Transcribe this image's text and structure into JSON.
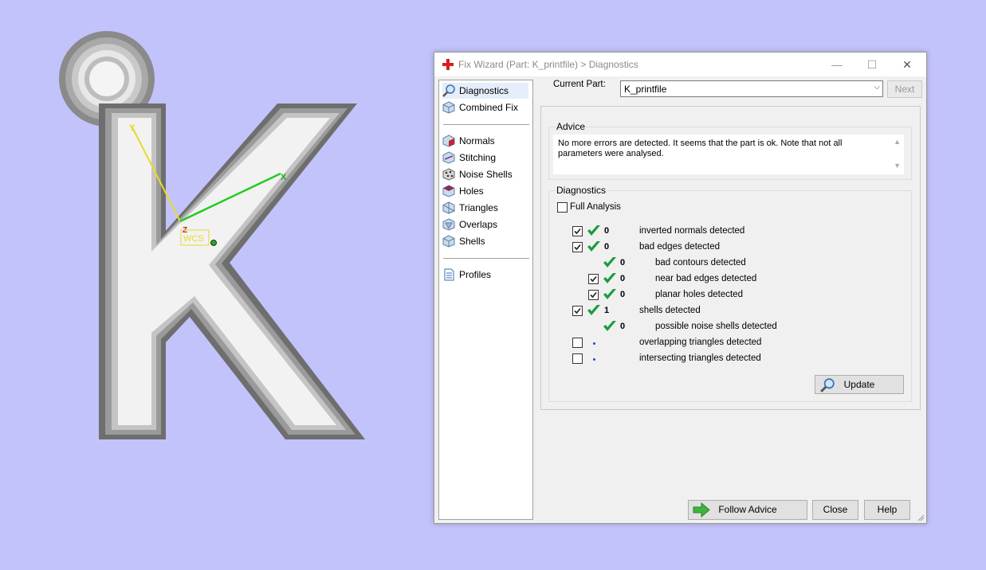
{
  "scene": {
    "axis_labels": {
      "y": "Y",
      "x": "X",
      "z": "Z"
    },
    "wcs_label": "WCS",
    "colors": {
      "background": "#c3c3fb",
      "axis_y": "#e0d830",
      "axis_x": "#22cc22"
    }
  },
  "dialog": {
    "title": "Fix Wizard (Part: K_printfile) > Diagnostics",
    "controls": {
      "minimize": "—",
      "maximize": "☐",
      "close": "✕"
    }
  },
  "nav": {
    "items_top": [
      {
        "label": "Diagnostics",
        "icon": "magnifier-icon",
        "selected": true
      },
      {
        "label": "Combined Fix",
        "icon": "cube-icon"
      }
    ],
    "items_fix": [
      {
        "label": "Normals",
        "icon": "normals-icon"
      },
      {
        "label": "Stitching",
        "icon": "stitching-icon"
      },
      {
        "label": "Noise Shells",
        "icon": "noise-shells-icon"
      },
      {
        "label": "Holes",
        "icon": "holes-icon"
      },
      {
        "label": "Triangles",
        "icon": "triangles-icon"
      },
      {
        "label": "Overlaps",
        "icon": "overlaps-icon"
      },
      {
        "label": "Shells",
        "icon": "shells-icon"
      }
    ],
    "items_bottom": [
      {
        "label": "Profiles",
        "icon": "document-icon"
      }
    ]
  },
  "current_part": {
    "label": "Current Part:",
    "value": "K_printfile",
    "next_label": "Next"
  },
  "advice": {
    "title": "Advice",
    "text": "No more errors are detected. It seems that the part is ok. Note that not all parameters were analysed."
  },
  "diagnostics": {
    "title": "Diagnostics",
    "full_analysis_label": "Full Analysis",
    "full_analysis_checked": false,
    "rows": [
      {
        "checkbox": true,
        "checked": true,
        "status": "ok",
        "count": "0",
        "label": "inverted normals detected",
        "indent": 0
      },
      {
        "checkbox": true,
        "checked": true,
        "status": "ok",
        "count": "0",
        "label": "bad edges detected",
        "indent": 0
      },
      {
        "checkbox": false,
        "checked": false,
        "status": "ok",
        "count": "0",
        "label": "bad contours detected",
        "indent": 1
      },
      {
        "checkbox": true,
        "checked": true,
        "status": "ok",
        "count": "0",
        "label": "near bad edges detected",
        "indent": 1
      },
      {
        "checkbox": true,
        "checked": true,
        "status": "ok",
        "count": "0",
        "label": "planar holes detected",
        "indent": 1
      },
      {
        "checkbox": true,
        "checked": true,
        "status": "ok",
        "count": "1",
        "label": "shells detected",
        "indent": 0
      },
      {
        "checkbox": false,
        "checked": false,
        "status": "ok",
        "count": "0",
        "label": "possible noise shells detected",
        "indent": 1
      },
      {
        "checkbox": true,
        "checked": false,
        "status": "pending",
        "count": "",
        "label": "overlapping triangles detected",
        "indent": 0
      },
      {
        "checkbox": true,
        "checked": false,
        "status": "pending",
        "count": "",
        "label": "intersecting triangles detected",
        "indent": 0
      }
    ],
    "update_label": "Update"
  },
  "footer": {
    "follow_advice_label": "Follow Advice",
    "close_label": "Close",
    "help_label": "Help"
  }
}
